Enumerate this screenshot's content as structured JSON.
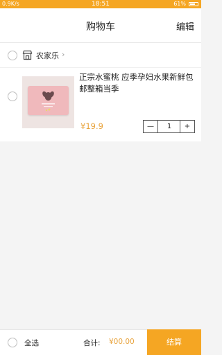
{
  "status_bar": {
    "left": "0.9K/s",
    "time": "18:51",
    "battery": "61%"
  },
  "header": {
    "title": "购物车",
    "edit_label": "编辑"
  },
  "shop": {
    "name": "农家乐",
    "arrow": "›"
  },
  "cart_items": [
    {
      "title": "正宗水蜜桃 应季孕妇水果新鲜包邮整箱当季",
      "price": "¥19.9",
      "quantity": "1",
      "minus": "—",
      "plus": "+"
    }
  ],
  "footer": {
    "select_all_label": "全选",
    "total_label": "合计:",
    "total_value": "¥00.00",
    "checkout_label": "结算"
  },
  "colors": {
    "accent": "#f5a623",
    "price": "#e8a23a"
  }
}
